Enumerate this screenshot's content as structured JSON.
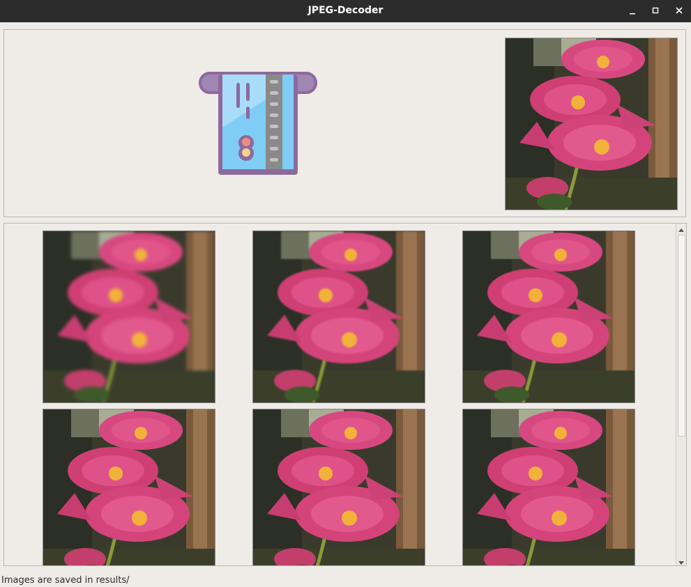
{
  "window": {
    "title": "JPEG-Decoder",
    "controls": {
      "minimize": "minimize-icon",
      "maximize": "maximize-icon",
      "close": "close-icon"
    }
  },
  "header_panel": {
    "icon": "credit-card-insert-icon",
    "preview_image": "hollyhock-flowers-original"
  },
  "results": {
    "images": [
      "hollyhock-result-1",
      "hollyhock-result-2",
      "hollyhock-result-3",
      "hollyhock-result-4",
      "hollyhock-result-5",
      "hollyhock-result-6"
    ]
  },
  "status": {
    "text": "Images are saved in results/"
  },
  "colors": {
    "titlebar": "#2c2c2c",
    "window_bg": "#efebe7",
    "flower_pink": "#d8457a",
    "flower_center": "#f2b23a",
    "card_blue": "#7fcdf5",
    "card_outline": "#8c6a9e"
  }
}
